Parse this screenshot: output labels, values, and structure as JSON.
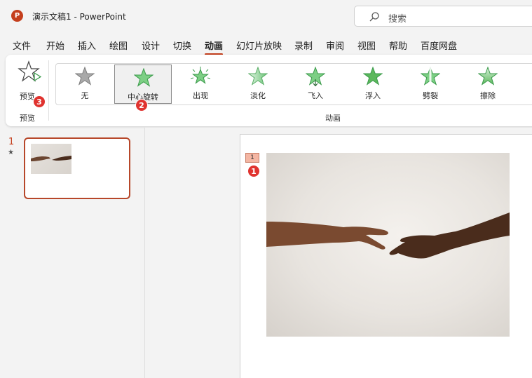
{
  "titlebar": {
    "logo_letter": "P",
    "title": "演示文稿1  -  PowerPoint",
    "search_placeholder": "搜索"
  },
  "menu": {
    "tabs": [
      {
        "label": "文件"
      },
      {
        "label": "开始"
      },
      {
        "label": "插入"
      },
      {
        "label": "绘图"
      },
      {
        "label": "设计"
      },
      {
        "label": "切换"
      },
      {
        "label": "动画",
        "active": true
      },
      {
        "label": "幻灯片放映"
      },
      {
        "label": "录制"
      },
      {
        "label": "审阅"
      },
      {
        "label": "视图"
      },
      {
        "label": "帮助"
      },
      {
        "label": "百度网盘"
      }
    ]
  },
  "ribbon": {
    "preview_label": "预览",
    "preview_group_label": "预览",
    "animation_group_label": "动画",
    "animations": [
      {
        "label": "无",
        "icon": "star-gray-icon"
      },
      {
        "label": "中心旋转",
        "icon": "star-green-icon",
        "selected": true
      },
      {
        "label": "出现",
        "icon": "star-burst-icon"
      },
      {
        "label": "淡化",
        "icon": "star-fade-icon"
      },
      {
        "label": "飞入",
        "icon": "star-fly-icon"
      },
      {
        "label": "浮入",
        "icon": "star-float-icon"
      },
      {
        "label": "劈裂",
        "icon": "star-split-icon"
      },
      {
        "label": "擦除",
        "icon": "star-wipe-icon"
      }
    ]
  },
  "badges": {
    "one": "1",
    "two": "2",
    "three": "3"
  },
  "slides_panel": {
    "slide_number": "1",
    "animation_marker": "★"
  },
  "slide": {
    "animation_tag": "1"
  },
  "colors": {
    "accent": "#c43e1c",
    "badge": "#e0332f",
    "star_green": "#5cb85c"
  }
}
